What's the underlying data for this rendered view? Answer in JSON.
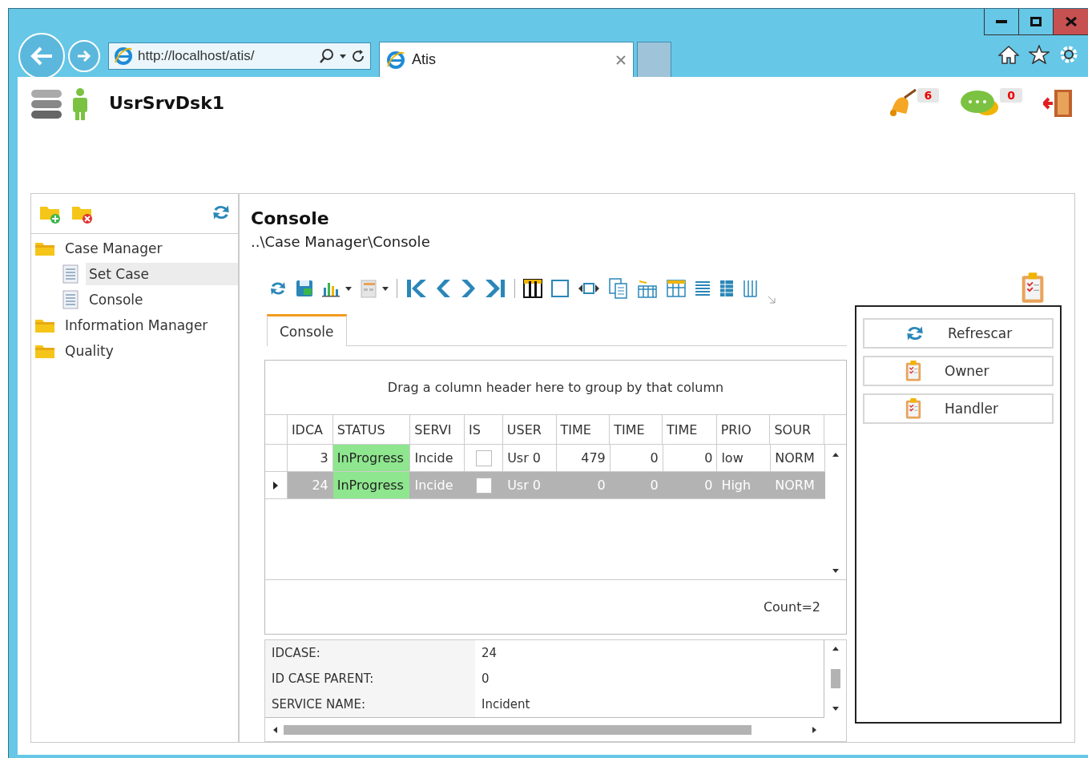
{
  "browser": {
    "address": "http://localhost/atis/",
    "tab_title": "Atis"
  },
  "app": {
    "title": "UsrSrvDsk1",
    "notifications": [
      {
        "kind": "bell",
        "count": "6"
      },
      {
        "kind": "chat",
        "count": "0"
      }
    ]
  },
  "sidebar": {
    "items": [
      {
        "label": "Case Manager",
        "selected": false,
        "children": [
          {
            "label": "Set Case",
            "selected": true
          },
          {
            "label": "Console",
            "selected": false
          }
        ]
      },
      {
        "label": "Information Manager",
        "selected": false
      },
      {
        "label": "Quality",
        "selected": false
      }
    ]
  },
  "content": {
    "title": "Console",
    "breadcrumb": "..\\Case Manager\\Console",
    "tabs": [
      {
        "label": "Console",
        "selected": true
      }
    ],
    "grid": {
      "group_hint": "Drag a column header here to group by that column",
      "columns": [
        "IDCA",
        "STATUS",
        "SERVI",
        "IS",
        "USER",
        "TIME",
        "TIME",
        "TIME",
        "PRIO",
        "SOUR"
      ],
      "rows": [
        {
          "selected": false,
          "cells": [
            {
              "kind": "number",
              "text": "3"
            },
            {
              "kind": "status",
              "text": "InProgress"
            },
            {
              "kind": "text",
              "text": "Incide"
            },
            {
              "kind": "check",
              "checked": false
            },
            {
              "kind": "text",
              "text": "Usr 0"
            },
            {
              "kind": "number",
              "text": "479"
            },
            {
              "kind": "number",
              "text": "0"
            },
            {
              "kind": "number",
              "text": "0"
            },
            {
              "kind": "text",
              "text": "low"
            },
            {
              "kind": "text",
              "text": "NORM"
            }
          ]
        },
        {
          "selected": true,
          "cells": [
            {
              "kind": "number",
              "text": "24"
            },
            {
              "kind": "status",
              "text": "InProgress"
            },
            {
              "kind": "text",
              "text": "Incide"
            },
            {
              "kind": "check",
              "checked": false
            },
            {
              "kind": "text",
              "text": "Usr 0"
            },
            {
              "kind": "number",
              "text": "0"
            },
            {
              "kind": "number",
              "text": "0"
            },
            {
              "kind": "number",
              "text": "0"
            },
            {
              "kind": "text",
              "text": "High"
            },
            {
              "kind": "text",
              "text": "NORM"
            }
          ]
        }
      ],
      "count": "Count=2"
    },
    "details": [
      {
        "label": "IDCASE:",
        "value": "24"
      },
      {
        "label": "ID CASE PARENT:",
        "value": "0"
      },
      {
        "label": "SERVICE NAME:",
        "value": "Incident"
      }
    ],
    "actions": [
      {
        "kind": "refresh",
        "label": "Refrescar"
      },
      {
        "kind": "clipboard",
        "label": "Owner"
      },
      {
        "kind": "clipboard",
        "label": "Handler"
      }
    ]
  }
}
